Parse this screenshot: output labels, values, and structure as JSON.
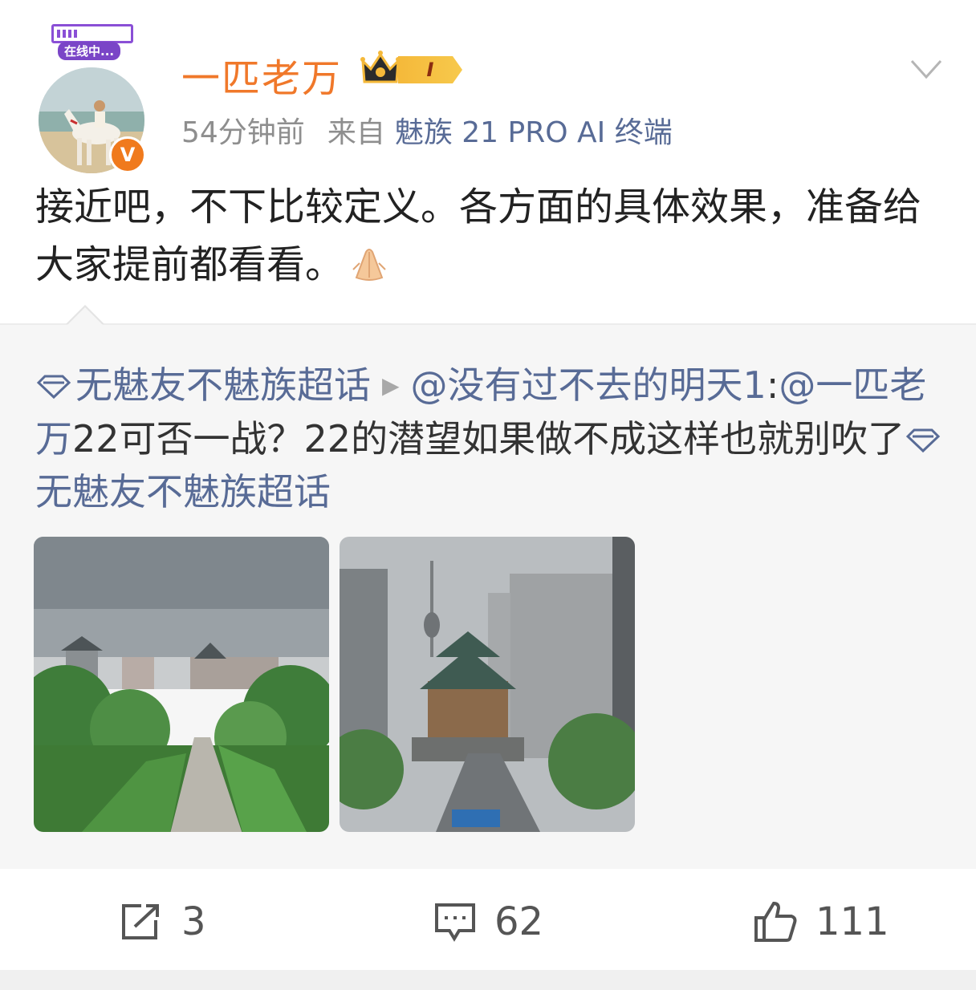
{
  "header": {
    "username": "一匹老万",
    "level": "I",
    "online_label": "在线中...",
    "time": "54分钟前",
    "from_label": "来自",
    "device": "魅族 21 PRO AI 终端",
    "verified_mark": "V"
  },
  "body": {
    "text": "接近吧，不下比较定义。各方面的具体效果，准备给大家提前都看看。"
  },
  "repost": {
    "topic": "无魅友不魅族超话",
    "mention": "@没有过不去的明天1",
    "colon": ":",
    "mention2": "@一匹老万",
    "text": "22可否一战？22的潜望如果做不成这样也就别吹了",
    "topic2": "无魅友不魅族超话"
  },
  "actions": {
    "repost_count": "3",
    "comment_count": "62",
    "like_count": "111"
  },
  "colors": {
    "username": "#f0782a",
    "link": "#586b96",
    "verified": "#f07a1d",
    "online": "#7a45c7"
  }
}
